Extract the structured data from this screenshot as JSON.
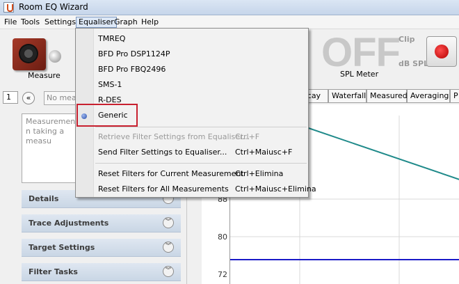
{
  "window": {
    "title": "Room EQ Wizard"
  },
  "menubar": [
    "File",
    "Tools",
    "Settings",
    "Equaliser",
    "Graph",
    "Help"
  ],
  "toolbar": {
    "measure_label": "Measure",
    "spl_value": "OFF",
    "clip_label": "Clip",
    "db_spl_label": "dB SPL",
    "spl_meter_label": "SPL Meter"
  },
  "left": {
    "index_value": "1",
    "measurement_placeholder": "No meas",
    "notes_text": "Measurement n taking a measu",
    "sections": [
      "Details",
      "Trace Adjustments",
      "Target Settings",
      "Filter Tasks"
    ]
  },
  "graph_tabs": [
    "ecay",
    "Waterfall",
    "Measured",
    "Averaging",
    "P"
  ],
  "graph": {
    "y_ticks": [
      "88",
      "80",
      "72"
    ],
    "colors": {
      "teal": "#1f8a8a",
      "blue": "#1a1ac8"
    }
  },
  "equaliser_menu": {
    "equalisers": [
      "TMREQ",
      "BFD Pro DSP1124P",
      "BFD Pro FBQ2496",
      "SMS-1",
      "R-DES",
      "Generic"
    ],
    "selected": "Generic",
    "actions": [
      {
        "label": "Retrieve Filter Settings from Equaliser...",
        "shortcut": "Ctrl+F",
        "enabled": false
      },
      {
        "label": "Send Filter Settings to Equaliser...",
        "shortcut": "Ctrl+Maiusc+F",
        "enabled": true
      },
      {
        "label": "Reset Filters for Current Measurement",
        "shortcut": "Ctrl+Elimina",
        "enabled": true
      },
      {
        "label": "Reset Filters for All Measurements",
        "shortcut": "Ctrl+Maiusc+Elimina",
        "enabled": true
      }
    ]
  }
}
